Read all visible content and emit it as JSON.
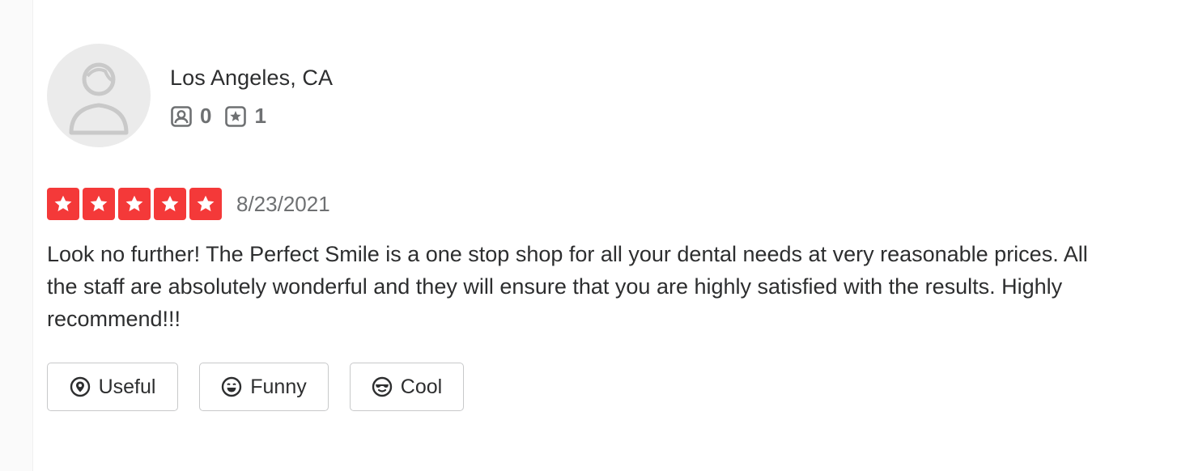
{
  "user": {
    "location": "Los Angeles, CA",
    "friends_icon": "friends-icon",
    "friends_count": "0",
    "reviews_icon": "review-star-icon",
    "reviews_count": "1"
  },
  "review": {
    "rating": 5,
    "rating_max": 5,
    "star_color": "#f43939",
    "date": "8/23/2021",
    "text": "Look no further! The Perfect Smile is a one stop shop for all your dental needs at very reasonable prices. All the staff are absolutely wonderful and they will ensure that you are highly satisfied with the results. Highly recommend!!!"
  },
  "reactions": {
    "useful_label": "Useful",
    "funny_label": "Funny",
    "cool_label": "Cool"
  }
}
